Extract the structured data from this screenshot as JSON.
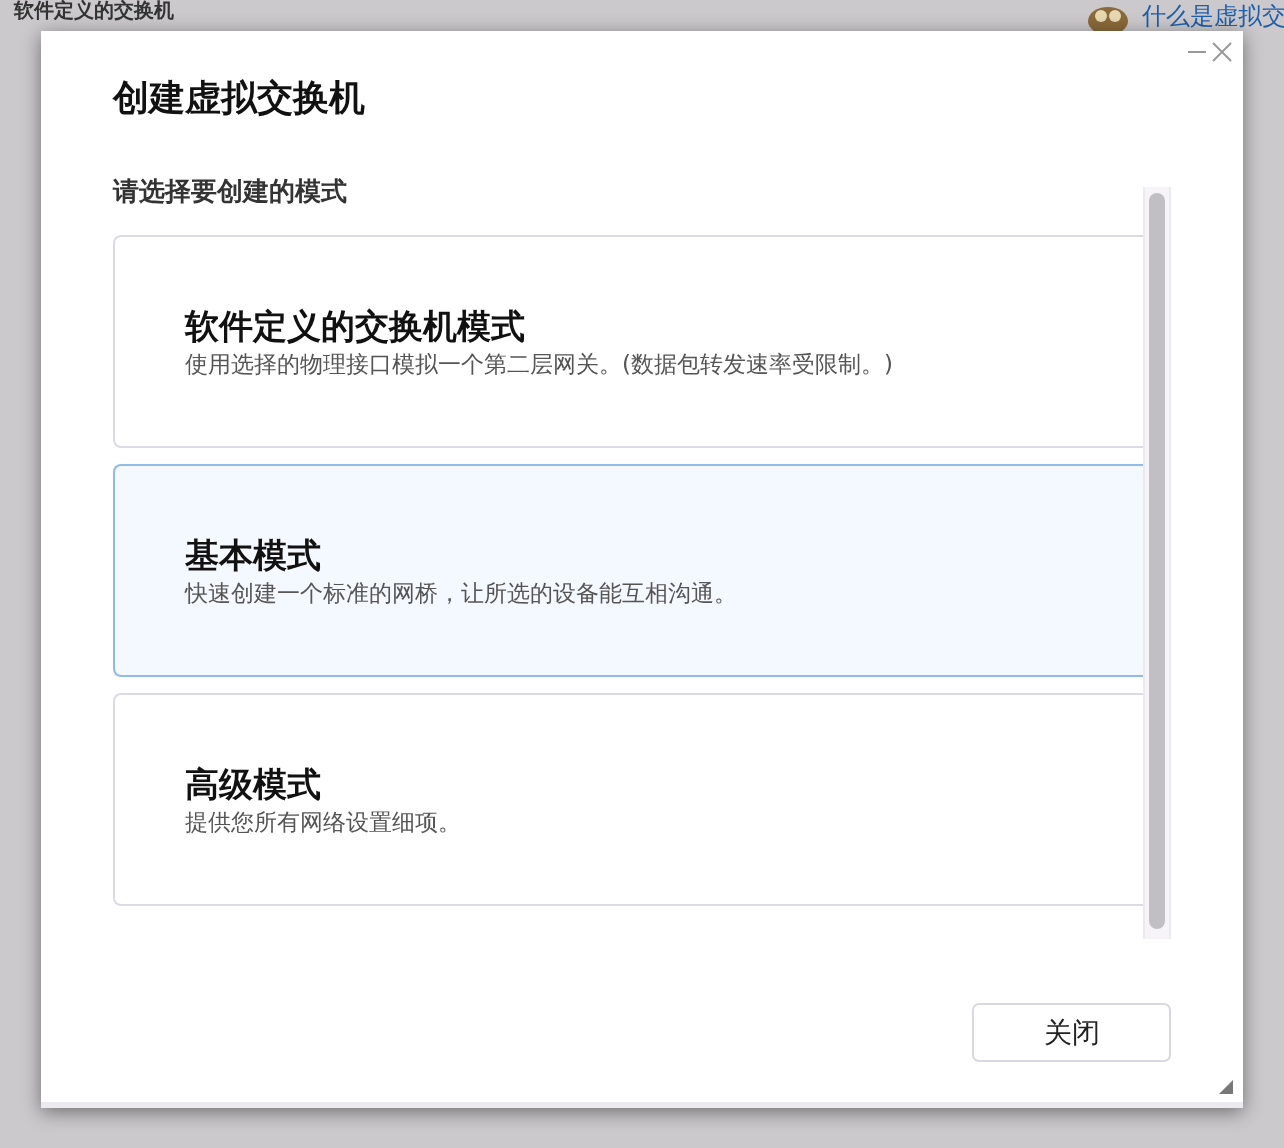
{
  "background": {
    "title": "软件定义的交换机",
    "help_link": "什么是虚拟交"
  },
  "dialog": {
    "title": "创建虚拟交换机",
    "prompt": "请选择要创建的模式",
    "modes": [
      {
        "title": "软件定义的交换机模式",
        "description": "使用选择的物理接口模拟一个第二层网关。(数据包转发速率受限制。)",
        "selected": false
      },
      {
        "title": "基本模式",
        "description": "快速创建一个标准的网桥，让所选的设备能互相沟通。",
        "selected": true
      },
      {
        "title": "高级模式",
        "description": "提供您所有网络设置细项。",
        "selected": false
      }
    ],
    "close_button": "关闭"
  }
}
